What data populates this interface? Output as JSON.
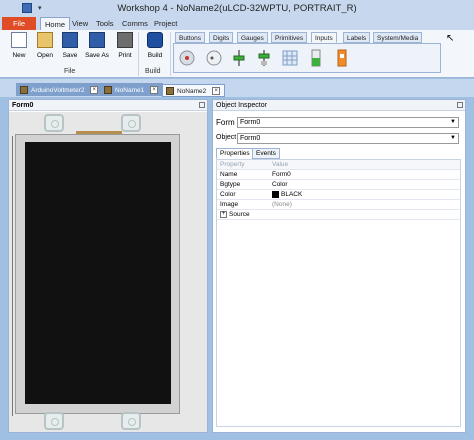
{
  "window": {
    "title": "Workshop 4 - NoName2(uLCD-32WPTU, PORTRAIT_R)"
  },
  "menu": {
    "file": "File",
    "tabs": [
      "Home",
      "View",
      "Tools",
      "Comms",
      "Project"
    ]
  },
  "ribbon": {
    "file_buttons": [
      "New",
      "Open",
      "Save",
      "Save As",
      "Print"
    ],
    "file_group": "File",
    "build_button": "Build",
    "build_group": "Build",
    "widget_tabs": [
      "Buttons",
      "Digits",
      "Gauges",
      "Primitives",
      "Inputs",
      "Labels",
      "System/Media"
    ],
    "active_widget_tab": "Inputs"
  },
  "doc_tabs": [
    {
      "label": "ArduinoVoltmeter2",
      "close": "×"
    },
    {
      "label": "NoName1",
      "close": "×"
    },
    {
      "label": "NoName2",
      "close": "×"
    }
  ],
  "form_pane": {
    "header": "Form0"
  },
  "inspector": {
    "header": "Object Inspector",
    "form_label": "Form",
    "form_value": "Form0",
    "object_label": "Object",
    "object_value": "Form0",
    "tabs": [
      "Properties",
      "Events"
    ],
    "columns": [
      "Property",
      "Value"
    ],
    "rows": [
      {
        "name": "Name",
        "value": "Form0"
      },
      {
        "name": "Bgtype",
        "value": "Color"
      },
      {
        "name": "Color",
        "value": "BLACK"
      },
      {
        "name": "Image",
        "value": "(None)"
      },
      {
        "name": "Source",
        "value": ""
      }
    ]
  },
  "colors": {
    "file_tab": "#e04c26",
    "ribbon_bg": "#f3f6fb",
    "screen": "#111111",
    "color_swatch": "#000000"
  }
}
